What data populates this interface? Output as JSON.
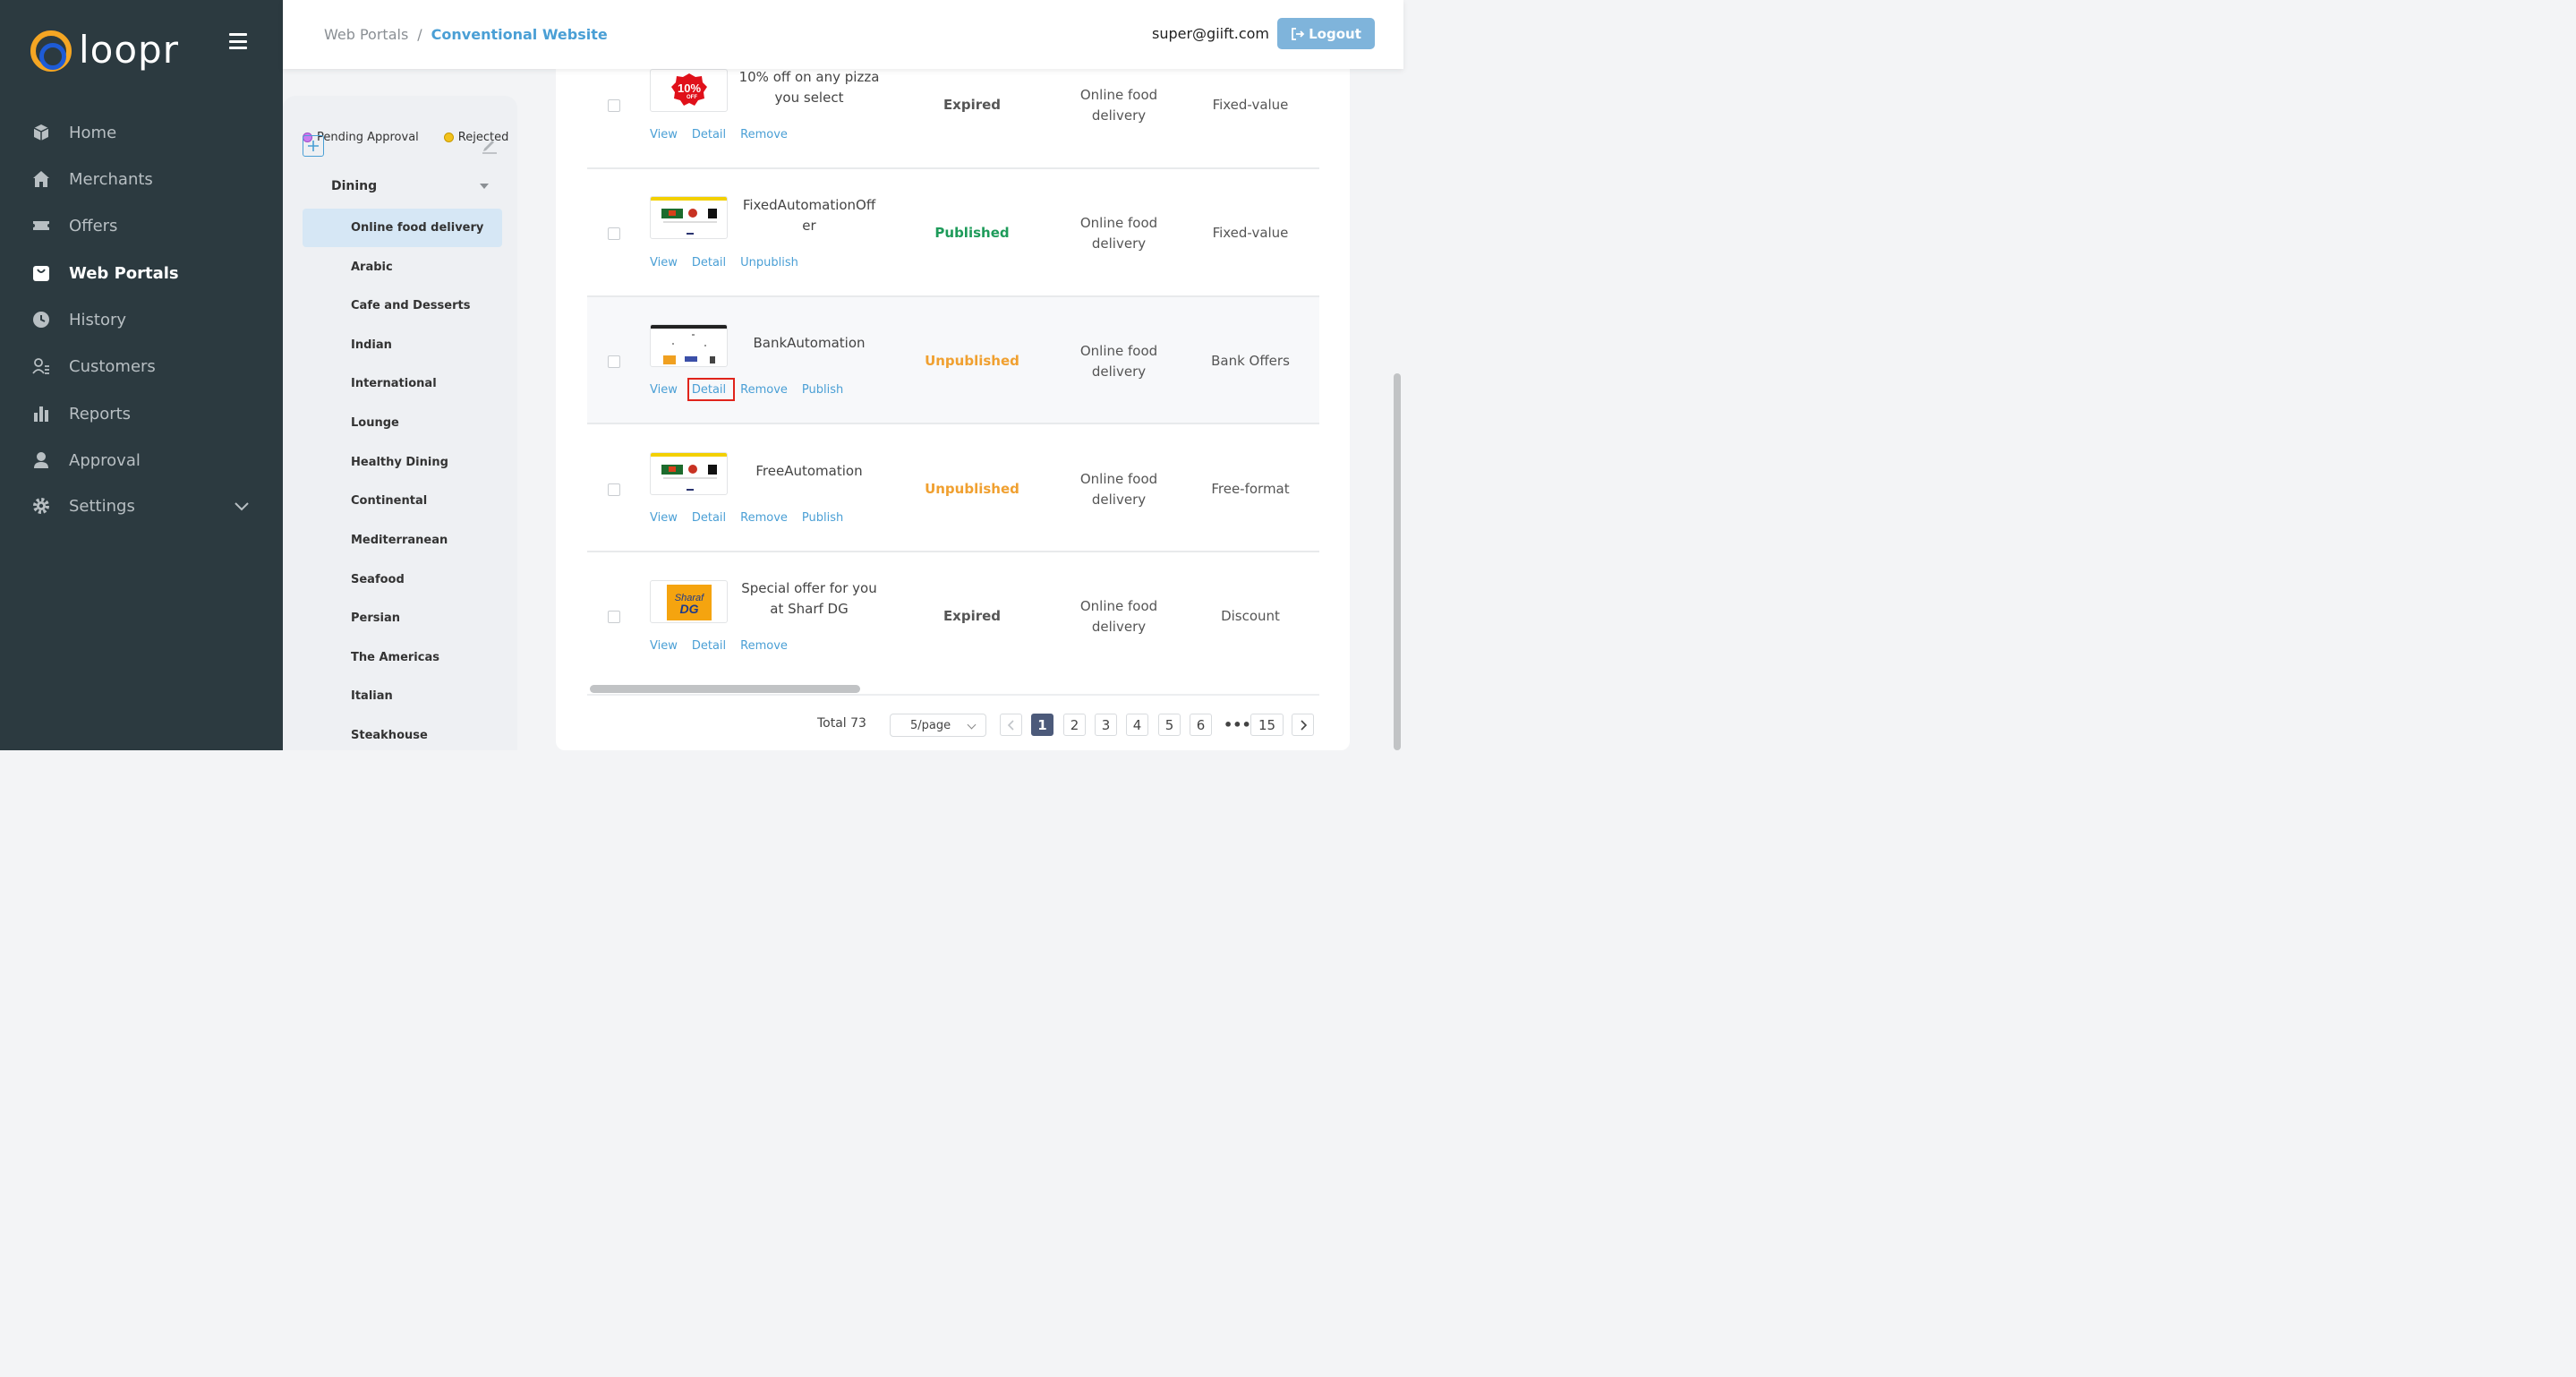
{
  "app": {
    "logo_text": "loopr"
  },
  "sidebar": {
    "items": [
      {
        "label": "Home",
        "icon": "cube-icon"
      },
      {
        "label": "Merchants",
        "icon": "store-icon"
      },
      {
        "label": "Offers",
        "icon": "ticket-icon"
      },
      {
        "label": "Web Portals",
        "icon": "bag-icon",
        "active": true
      },
      {
        "label": "History",
        "icon": "clock-icon"
      },
      {
        "label": "Customers",
        "icon": "users-icon"
      },
      {
        "label": "Reports",
        "icon": "bar-chart-icon"
      },
      {
        "label": "Approval",
        "icon": "user-check-icon"
      },
      {
        "label": "Settings",
        "icon": "gear-icon"
      }
    ]
  },
  "header": {
    "breadcrumb": {
      "root": "Web Portals",
      "separator": "/",
      "current": "Conventional Website"
    },
    "user_email": "super@giift.com",
    "logout_label": "Logout"
  },
  "categories": {
    "legend": [
      {
        "label": "Pending Approval",
        "color": "#c97cf0"
      },
      {
        "label": "Rejected",
        "color": "#f2c21c"
      }
    ],
    "group": "Dining",
    "items": [
      "Online food delivery",
      "Arabic",
      "Cafe and Desserts",
      "Indian",
      "International",
      "Lounge",
      "Healthy Dining",
      "Continental",
      "Mediterranean",
      "Seafood",
      "Persian",
      "The Americas",
      "Italian",
      "Steakhouse"
    ],
    "selected": "Online food delivery"
  },
  "offers": {
    "rows": [
      {
        "title_l1": "10% off on any pizza",
        "title_l2": "you select",
        "status": "Expired",
        "category_l1": "Online food",
        "category_l2": "delivery",
        "type": "Fixed-value",
        "actions": [
          "View",
          "Detail",
          "Remove"
        ],
        "thumb": "pizza-discount"
      },
      {
        "title_l1": "FixedAutomationOff",
        "title_l2": "er",
        "status": "Published",
        "category_l1": "Online food",
        "category_l2": "delivery",
        "type": "Fixed-value",
        "actions": [
          "View",
          "Detail",
          "Unpublish"
        ],
        "thumb": "food-banner"
      },
      {
        "title_l1": "BankAutomation",
        "title_l2": "",
        "status": "Unpublished",
        "category_l1": "Online food",
        "category_l2": "delivery",
        "type": "Bank Offers",
        "actions": [
          "View",
          "Detail",
          "Remove",
          "Publish"
        ],
        "thumb": "bank-banner"
      },
      {
        "title_l1": "FreeAutomation",
        "title_l2": "",
        "status": "Unpublished",
        "category_l1": "Online food",
        "category_l2": "delivery",
        "type": "Free-format",
        "actions": [
          "View",
          "Detail",
          "Remove",
          "Publish"
        ],
        "thumb": "food-banner"
      },
      {
        "title_l1": "Special offer for you",
        "title_l2": "at Sharf DG",
        "status": "Expired",
        "category_l1": "Online food",
        "category_l2": "delivery",
        "type": "Discount",
        "actions": [
          "View",
          "Detail",
          "Remove"
        ],
        "thumb": "sharaf-dg"
      }
    ],
    "thumb_text": {
      "pizza_top": "10%",
      "pizza_bottom": "OFF",
      "sharaf_top": "Sharaf",
      "sharaf_bottom": "DG"
    }
  },
  "status_colors": {
    "Expired": "#555555",
    "Published": "#1e9b5a",
    "Unpublished": "#f0a030"
  },
  "pagination": {
    "total_label": "Total 73",
    "page_size": "5/page",
    "pages": [
      "1",
      "2",
      "3",
      "4",
      "5",
      "6"
    ],
    "ellipsis": "•••",
    "last_page": "15",
    "current": "1"
  }
}
